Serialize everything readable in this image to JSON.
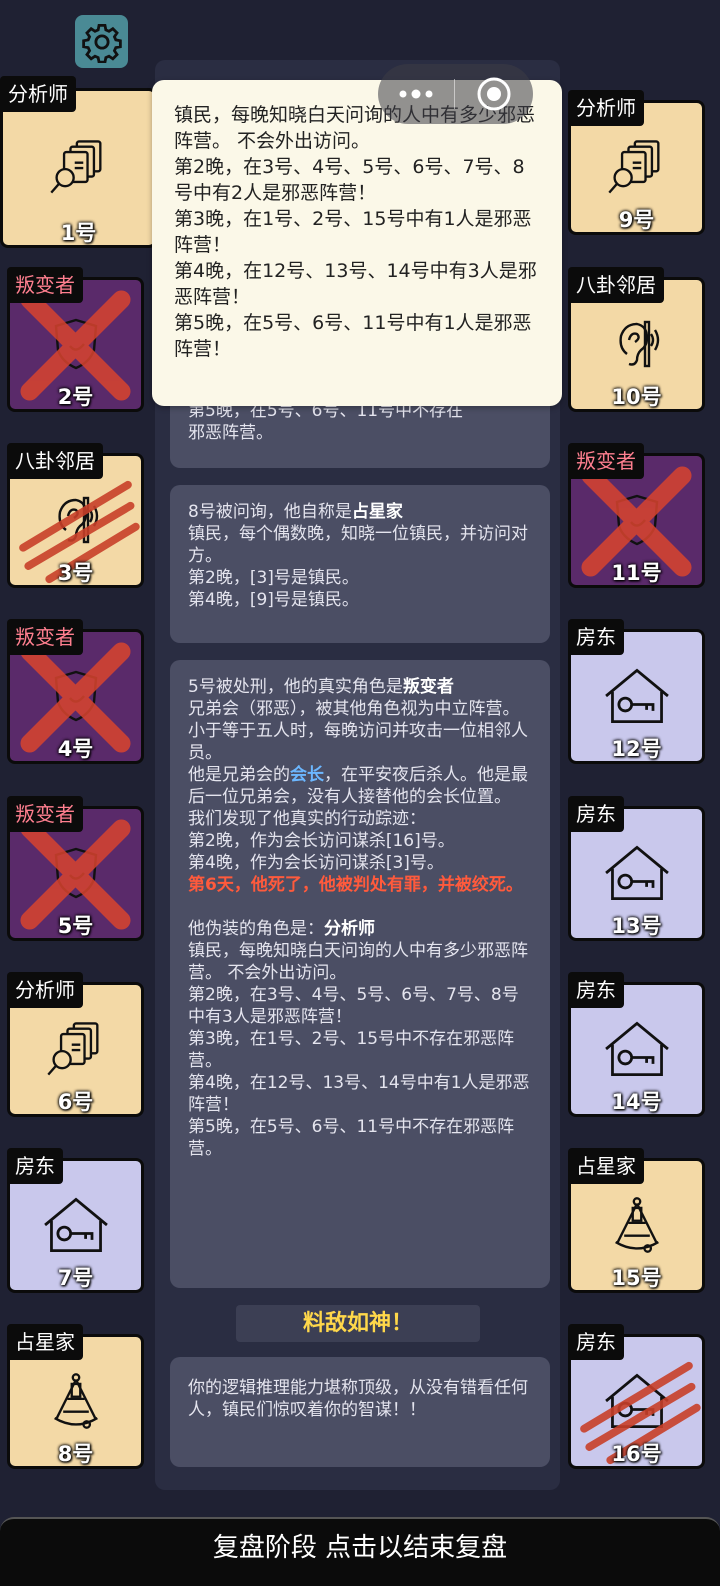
{
  "players": [
    {
      "num": "1号",
      "role": "分析师",
      "theme": "tan",
      "icon": "documents-search-icon",
      "dead": false
    },
    {
      "num": "2号",
      "role": "叛变者",
      "theme": "purple",
      "icon": "shield-icon",
      "dead": true
    },
    {
      "num": "3号",
      "role": "八卦邻居",
      "theme": "tan",
      "icon": "ear-icon",
      "dead": true
    },
    {
      "num": "4号",
      "role": "叛变者",
      "theme": "purple",
      "icon": "shield-icon",
      "dead": true
    },
    {
      "num": "5号",
      "role": "叛变者",
      "theme": "purple",
      "icon": "shield-icon",
      "dead": true
    },
    {
      "num": "6号",
      "role": "分析师",
      "theme": "tan",
      "icon": "documents-search-icon",
      "dead": false
    },
    {
      "num": "7号",
      "role": "房东",
      "theme": "lavender",
      "icon": "house-key-icon",
      "dead": false
    },
    {
      "num": "8号",
      "role": "占星家",
      "theme": "tan",
      "icon": "sextant-icon",
      "dead": false
    },
    {
      "num": "9号",
      "role": "分析师",
      "theme": "tan",
      "icon": "documents-search-icon",
      "dead": false
    },
    {
      "num": "10号",
      "role": "八卦邻居",
      "theme": "tan",
      "icon": "ear-icon",
      "dead": false
    },
    {
      "num": "11号",
      "role": "叛变者",
      "theme": "purple",
      "icon": "shield-icon",
      "dead": true
    },
    {
      "num": "12号",
      "role": "房东",
      "theme": "lavender",
      "icon": "house-key-icon",
      "dead": false
    },
    {
      "num": "13号",
      "role": "房东",
      "theme": "lavender",
      "icon": "house-key-icon",
      "dead": false
    },
    {
      "num": "14号",
      "role": "房东",
      "theme": "lavender",
      "icon": "house-key-icon",
      "dead": false
    },
    {
      "num": "15号",
      "role": "占星家",
      "theme": "tan",
      "icon": "sextant-icon",
      "dead": false
    },
    {
      "num": "16号",
      "role": "房东",
      "theme": "lavender",
      "icon": "house-key-icon",
      "dead": true
    }
  ],
  "colors": {
    "tan": "#f3d9a6",
    "purple": "#5a2a6a",
    "lavender": "#c9c8ec",
    "cross": "#d9442e",
    "claw": "#c8402a"
  },
  "popup": {
    "lines": [
      "镇民，每晚知晓白天问询的人中有多少邪恶阵营。 不会外出访问。",
      "第2晚，在3号、4号、5号、6号、7号、8号中有2人是邪恶阵营！",
      "第3晚，在1号、2号、15号中有1人是邪恶阵营！",
      "第4晚，在12号、13号、14号中有3人是邪恶阵营！",
      "第5晚，在5号、6号、11号中有1人是邪恶阵营！"
    ]
  },
  "bubble_top": {
    "lines": [
      "第5晚，在5号、6号、11号中不存在",
      "邪恶阵营。"
    ]
  },
  "bubble_8": {
    "intro": "8号被问询，他自称是",
    "role": "占星家",
    "lines": [
      "镇民，每个偶数晚，知晓一位镇民，并访问对方。",
      "第2晚，[3]号是镇民。",
      "第4晚，[9]号是镇民。"
    ]
  },
  "bubble_5": {
    "intro": "5号被处刑，他的真实角色是",
    "role": "叛变者",
    "desc": "兄弟会（邪恶），被其他角色视为中立阵营。小于等于五人时，每晚访问并攻击一位相邻人员。",
    "pre": "他是兄弟会的",
    "leader": "会长",
    "post": "，在平安夜后杀人。他是最后一位兄弟会，没有人接替他的会长位置。",
    "trace_lines": [
      "我们发现了他真实的行动踪迹：",
      "第2晚，作为会长访问谋杀[16]号。",
      "第4晚，作为会长访问谋杀[3]号。"
    ],
    "death": "第6天，他死了，他被判处有罪，并被绞死。",
    "fake_intro": "他伪装的角色是：",
    "fake_role": "分析师",
    "fake_lines": [
      "镇民，每晚知晓白天问询的人中有多少邪恶阵营。 不会外出访问。",
      "第2晚，在3号、4号、5号、6号、7号、8号中有3人是邪恶阵营！",
      "第3晚，在1号、2号、15号中不存在邪恶阵营。",
      "第4晚，在12号、13号、14号中有1人是邪恶阵营！",
      "第5晚，在5号、6号、11号中不存在邪恶阵营。"
    ]
  },
  "banner": "料敌如神！",
  "final": "你的逻辑推理能力堪称顶级，从没有错看任何人，镇民们惊叹着你的智谋！！",
  "bottom_bar": "复盘阶段 点击以结束复盘"
}
